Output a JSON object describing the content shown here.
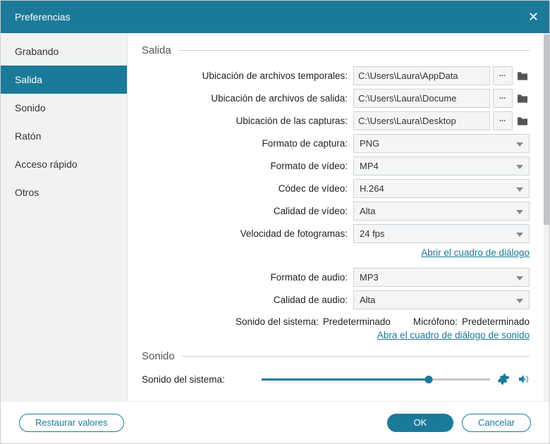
{
  "title": "Preferencias",
  "sidebar": {
    "items": [
      {
        "label": "Grabando"
      },
      {
        "label": "Salida"
      },
      {
        "label": "Sonido"
      },
      {
        "label": "Ratón"
      },
      {
        "label": "Acceso rápido"
      },
      {
        "label": "Otros"
      }
    ],
    "activeIndex": 1
  },
  "sections": {
    "output": {
      "heading": "Salida",
      "tempPath": {
        "label": "Ubicación de archivos temporales:",
        "value": "C:\\Users\\Laura\\AppData"
      },
      "outputPath": {
        "label": "Ubicación de archivos de salida:",
        "value": "C:\\Users\\Laura\\Docume"
      },
      "screenshotPath": {
        "label": "Ubicación de las capturas:",
        "value": "C:\\Users\\Laura\\Desktop"
      },
      "captureFormat": {
        "label": "Formato de captura:",
        "value": "PNG"
      },
      "videoFormat": {
        "label": "Formato de vídeo:",
        "value": "MP4"
      },
      "videoCodec": {
        "label": "Códec de vídeo:",
        "value": "H.264"
      },
      "videoQuality": {
        "label": "Calidad de vídeo:",
        "value": "Alta"
      },
      "frameRate": {
        "label": "Velocidad de fotogramas:",
        "value": "24 fps"
      },
      "dialogLink": "Abrir el cuadro de diálogo",
      "audioFormat": {
        "label": "Formato de audio:",
        "value": "MP3"
      },
      "audioQuality": {
        "label": "Calidad de audio:",
        "value": "Alta"
      },
      "systemSound": {
        "label": "Sonido del sistema:",
        "value": "Predeterminado"
      },
      "microphone": {
        "label": "Micrófono:",
        "value": "Predeterminado"
      },
      "soundDialogLink": "Abra el cuadro de diálogo de sonido"
    },
    "sound": {
      "heading": "Sonido",
      "systemSoundLabel": "Sonido del sistema:"
    }
  },
  "footer": {
    "restore": "Restaurar valores",
    "ok": "OK",
    "cancel": "Cancelar"
  }
}
